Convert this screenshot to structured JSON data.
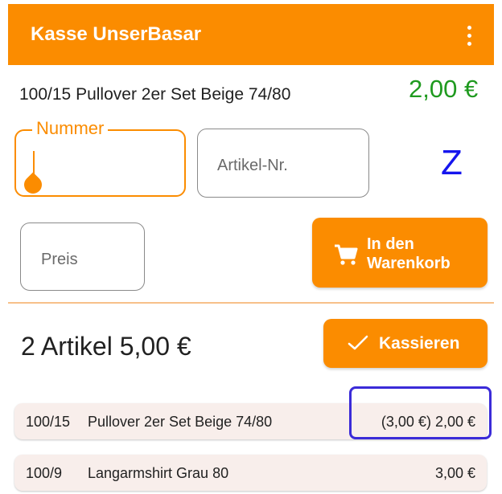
{
  "app": {
    "title": "Kasse UnserBasar",
    "menu_icon": "more-vert-icon"
  },
  "current_item": {
    "text": "100/15 Pullover 2er Set Beige 74/80",
    "price": "2,00 €",
    "price_color": "#1f9a1f"
  },
  "form": {
    "nummer": {
      "label": "Nummer",
      "value": ""
    },
    "artikel_nr": {
      "placeholder": "Artikel-Nr."
    },
    "z_indicator": "Z",
    "preis": {
      "placeholder": "Preis"
    },
    "add_to_cart": {
      "label": "In den\nWarenkorb",
      "icon": "cart-icon"
    }
  },
  "cart": {
    "summary": "2 Artikel 5,00 €",
    "checkout": {
      "label": "Kassieren",
      "icon": "check-icon"
    },
    "items": [
      {
        "nr": "100/15",
        "name": "Pullover 2er Set Beige 74/80",
        "price": "(3,00 €) 2,00 €"
      },
      {
        "nr": "100/9",
        "name": "Langarmshirt Grau 80",
        "price": "3,00 €"
      }
    ]
  },
  "colors": {
    "accent": "#fb8c00",
    "highlight": "#3b2bd8",
    "z_letter": "#1515ee"
  }
}
